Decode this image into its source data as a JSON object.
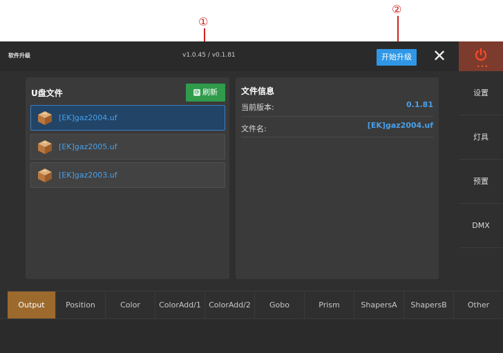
{
  "annotations": {
    "one": "①",
    "two": "②"
  },
  "topbar": {
    "title": "软件升级",
    "version": "v1.0.45 / v0.1.81",
    "start_upgrade": "开始升级",
    "close": "✕"
  },
  "power": {
    "dots": "•••",
    "color": "#ff4a2a"
  },
  "sidebar": {
    "items": [
      {
        "label": "设置"
      },
      {
        "label": "灯具"
      },
      {
        "label": "预置"
      },
      {
        "label": "DMX"
      }
    ]
  },
  "files": {
    "title": "U盘文件",
    "refresh": "刷新",
    "items": [
      {
        "name": "[EK]gaz2004.uf",
        "selected": true
      },
      {
        "name": "[EK]gaz2005.uf",
        "selected": false
      },
      {
        "name": "[EK]gaz2003.uf",
        "selected": false
      }
    ]
  },
  "info": {
    "title": "文件信息",
    "current_version_label": "当前版本:",
    "current_version_value": "0.1.81",
    "filename_label": "文件名:",
    "filename_value": "[EK]gaz2004.uf"
  },
  "tabs": [
    {
      "label": "Output",
      "active": true
    },
    {
      "label": "Position"
    },
    {
      "label": "Color"
    },
    {
      "label": "ColorAdd/1"
    },
    {
      "label": "ColorAdd/2"
    },
    {
      "label": "Gobo"
    },
    {
      "label": "Prism"
    },
    {
      "label": "ShapersA"
    },
    {
      "label": "ShapersB"
    },
    {
      "label": "Other"
    }
  ],
  "colors": {
    "accent": "#2f97e6",
    "refresh": "#2f9b4b",
    "active_tab": "#9c6a2d",
    "power_bg": "#7d3b2e"
  }
}
